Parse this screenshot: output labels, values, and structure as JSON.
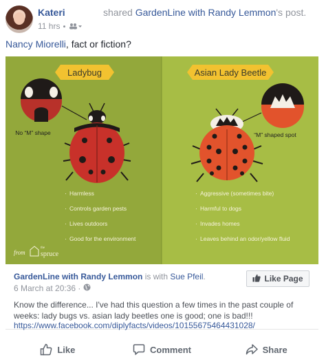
{
  "post": {
    "author": "Kateri",
    "shared_prefix": "shared",
    "shared_page": "GardenLine with Randy Lemmon",
    "shared_suffix": "'s post.",
    "time": "11 hrs",
    "mention": "Nancy Miorelli",
    "text_suffix": ", fact or fiction?"
  },
  "infographic": {
    "ladybug": {
      "title": "Ladybug",
      "callout": "No “M” shape",
      "facts": [
        "Harmless",
        "Controls garden pests",
        "Lives outdoors",
        "Good for the environment"
      ]
    },
    "beetle": {
      "title": "Asian Lady Beetle",
      "callout": "“M” shaped spot",
      "facts": [
        "Aggressive (sometimes bite)",
        "Harmful to dogs",
        "Invades homes",
        "Leaves behind an odor/yellow fluid"
      ]
    },
    "credit_from": "from",
    "credit_the": "the",
    "credit_brand": "spruce",
    "colors": {
      "left_bg": "#93a83b",
      "right_bg": "#a7bd45",
      "banner": "#f2c230",
      "ladybug_shell": "#c8312a",
      "beetle_shell": "#e2532c"
    }
  },
  "shared_card": {
    "page_name": "GardenLine with Randy Lemmon",
    "is_with": "is with",
    "tagged": "Sue Pfeil",
    "period": ".",
    "date": "6 March at 20:36 ·",
    "like_page": "Like Page",
    "description": "Know the difference... I've had this question a few times in the past couple of weeks: lady bugs vs. asian lady beetles one is good; one is bad!!!",
    "link": "https://www.facebook.com/diplyfacts/videos/10155675464431028/"
  },
  "actions": {
    "like": "Like",
    "comment": "Comment",
    "share": "Share"
  }
}
